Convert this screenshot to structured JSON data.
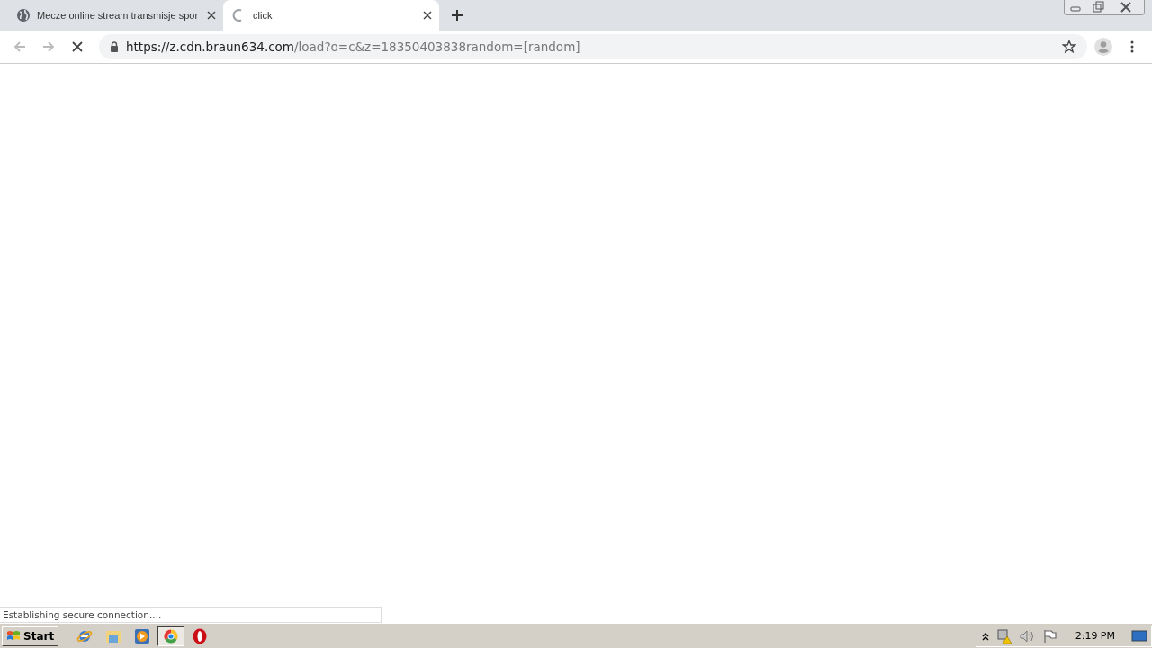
{
  "tabs": [
    {
      "title": "Mecze online stream transmisje spor",
      "kind": "globe",
      "selected": false
    },
    {
      "title": "click",
      "kind": "loading",
      "selected": true
    }
  ],
  "toolbar": {
    "back_disabled": true,
    "forward_disabled": true,
    "loading": true
  },
  "address_bar": {
    "host": "https://z.cdn.braun634.com",
    "path": "/load?o=c&z=18350403838random=[random]"
  },
  "status_bubble": "Establishing secure connection....",
  "taskbar": {
    "start": "Start",
    "apps": [
      {
        "kind": "ie",
        "selected": false
      },
      {
        "kind": "folder",
        "selected": false
      },
      {
        "kind": "media",
        "selected": false
      },
      {
        "kind": "chrome",
        "selected": true
      },
      {
        "kind": "opera",
        "selected": false
      }
    ],
    "clock": "2:19 PM"
  }
}
